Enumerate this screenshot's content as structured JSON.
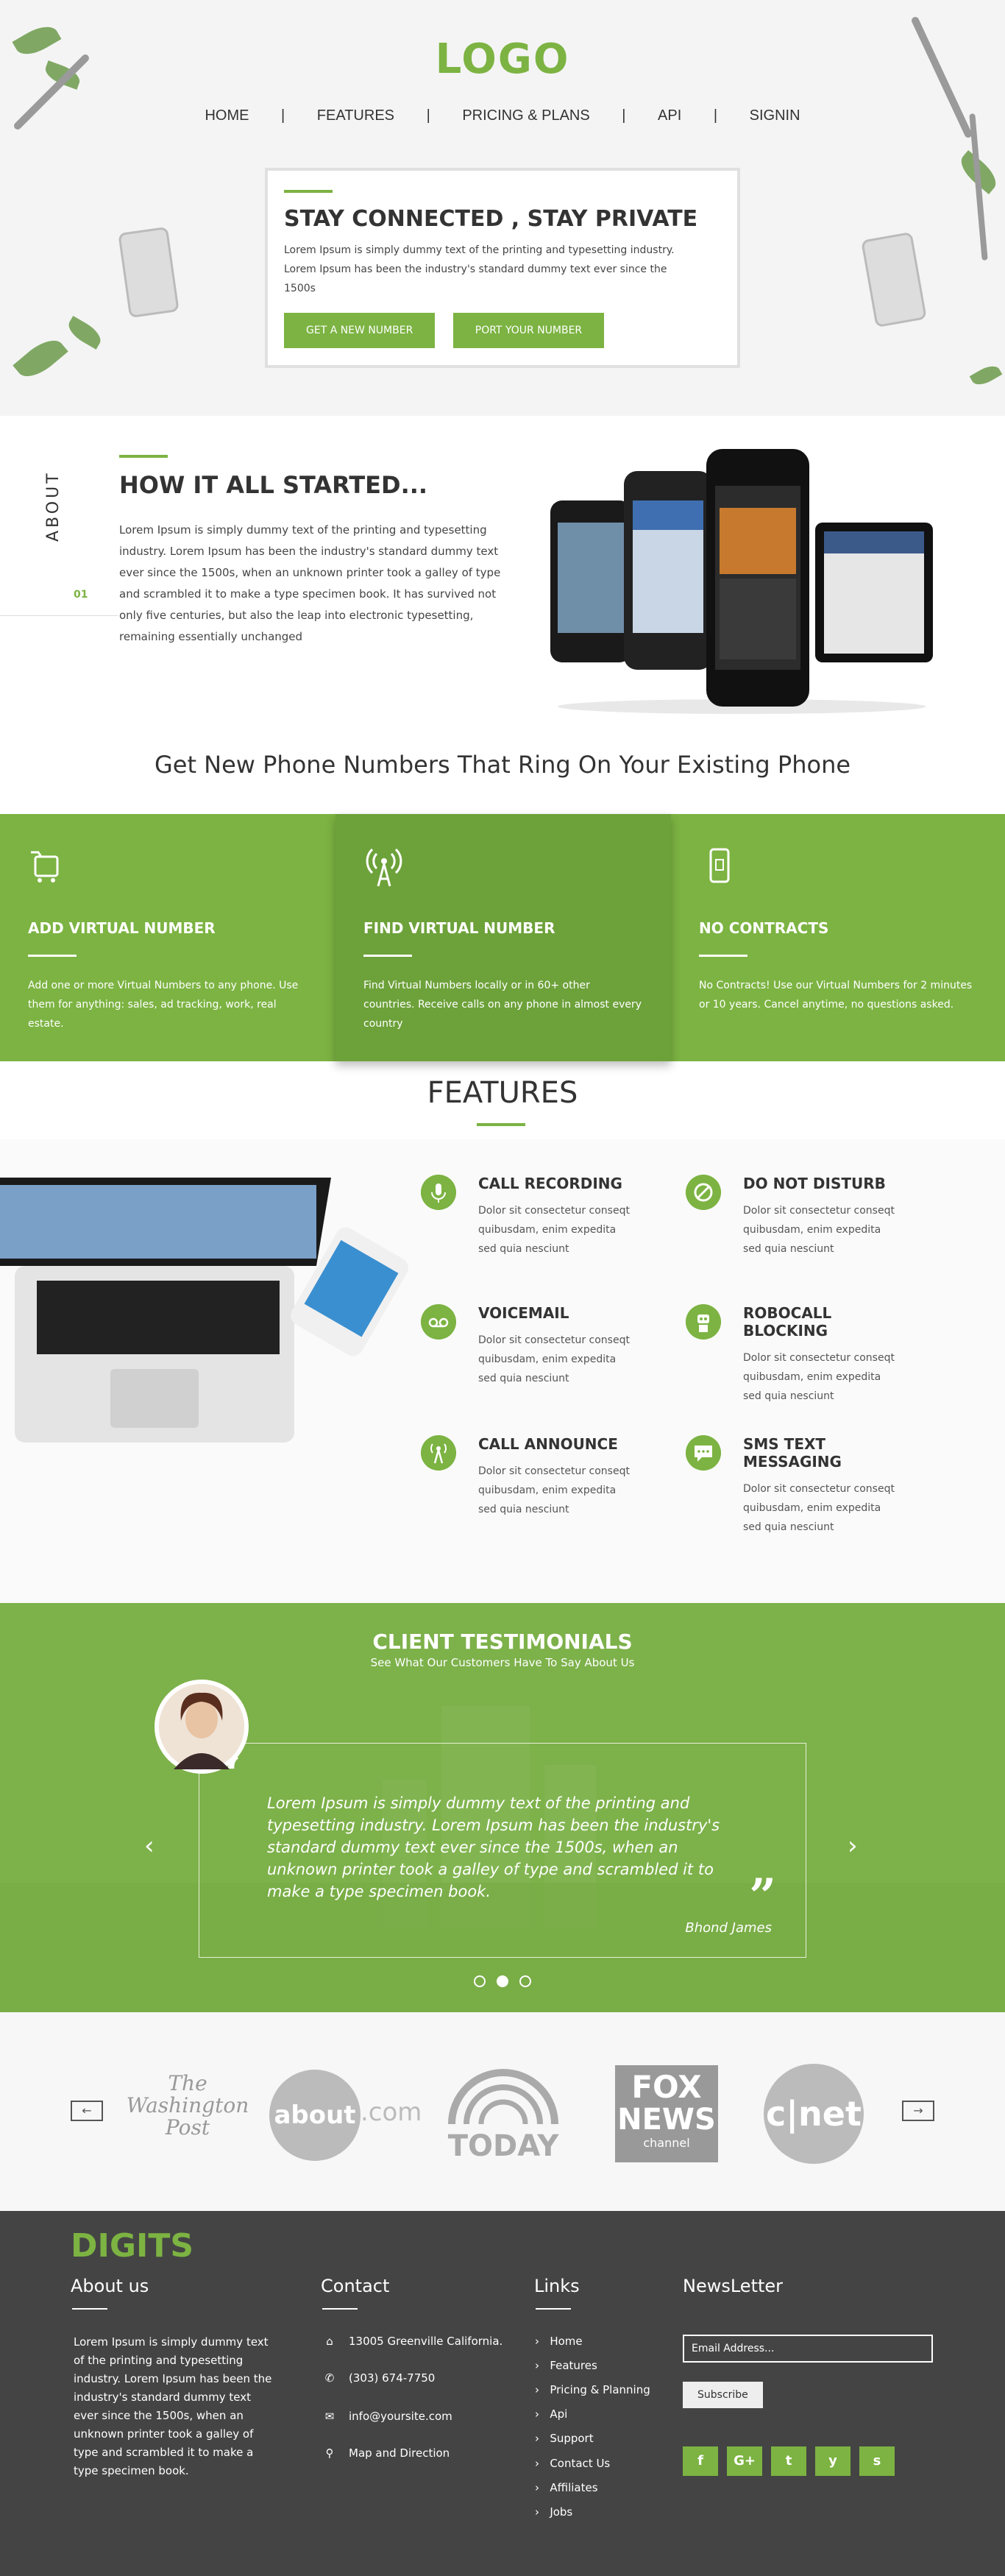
{
  "header": {
    "logo": "LOGO",
    "nav": [
      "HOME",
      "FEATURES",
      "PRICING & PLANS",
      "API",
      "SIGNIN"
    ],
    "hero_title": "STAY CONNECTED , STAY PRIVATE",
    "hero_text": "Lorem Ipsum is simply dummy text of the printing and typesetting industry. Lorem Ipsum has been the industry's standard dummy text ever since the 1500s",
    "btn_new": "GET A NEW NUMBER",
    "btn_port": "PORT YOUR NUMBER"
  },
  "about": {
    "label": "ABOUT",
    "number": "01",
    "title": "HOW IT ALL STARTED...",
    "text": "Lorem Ipsum is simply dummy text of the printing and typesetting industry. Lorem Ipsum has been the industry's standard dummy text ever since the 1500s, when an unknown printer took a galley of type and scrambled it to make a type specimen book. It has survived not only five centuries, but also the leap into electronic typesetting, remaining essentially unchanged"
  },
  "subheading": "Get New Phone Numbers That Ring On Your Existing Phone",
  "green_features": [
    {
      "title": "ADD VIRTUAL NUMBER",
      "text": "Add one or more Virtual Numbers to any phone. Use them for anything: sales, ad tracking, work, real estate."
    },
    {
      "title": "FIND VIRTUAL NUMBER",
      "text": "Find Virtual Numbers locally or in 60+ other countries. Receive calls on any phone in almost every country"
    },
    {
      "title": "NO CONTRACTS",
      "text": "No Contracts! Use our Virtual Numbers for 2 minutes or 10 years. Cancel anytime, no questions asked."
    }
  ],
  "features": {
    "title": "FEATURES",
    "items": [
      {
        "title": "CALL RECORDING",
        "text": "Dolor sit consectetur conseqt quibusdam, enim expedita sed quia nesciunt",
        "icon": "mic-icon"
      },
      {
        "title": "DO NOT DISTURB",
        "text": "Dolor sit consectetur conseqt quibusdam, enim expedita sed quia nesciunt",
        "icon": "block-icon"
      },
      {
        "title": "VOICEMAIL",
        "text": "Dolor sit consectetur conseqt quibusdam, enim expedita sed quia nesciunt",
        "icon": "voicemail-icon"
      },
      {
        "title": "ROBOCALL BLOCKING",
        "text": "Dolor sit consectetur conseqt quibusdam, enim expedita sed quia nesciunt",
        "icon": "robot-icon"
      },
      {
        "title": "CALL ANNOUNCE",
        "text": "Dolor sit consectetur conseqt quibusdam, enim expedita sed quia nesciunt",
        "icon": "antenna-icon"
      },
      {
        "title": "SMS TEXT MESSAGING",
        "text": "Dolor sit consectetur conseqt quibusdam, enim expedita sed quia nesciunt",
        "icon": "chat-icon"
      }
    ]
  },
  "testimonials": {
    "title": "CLIENT TESTIMONIALS",
    "subtitle": "See What Our Customers Have To Say About Us",
    "quote": "Lorem Ipsum is simply dummy text of the printing and typesetting industry. Lorem Ipsum has been the industry's standard dummy text ever since the 1500s, when an unknown printer took a galley of type and scrambled it to make a type specimen book.",
    "author": "Bhond James",
    "open_quote": "“",
    "close_quote": "”",
    "prev": "‹",
    "next": "›"
  },
  "press_logos": {
    "wp1": "The",
    "wp2": "Washington",
    "wp3": "Post",
    "about": "about",
    "about_com": ".com",
    "today": "TODAY",
    "fox1": "FOX",
    "fox2": "NEWS",
    "fox3": "channel",
    "cnet": "c|net"
  },
  "footer": {
    "brand": "DIGITS",
    "about_title": "About us",
    "about_text": "Lorem Ipsum is simply dummy text of the printing and typesetting industry. Lorem Ipsum has been the industry's standard dummy text ever since the 1500s, when an unknown printer took a galley of type and scrambled it to make a type specimen book.",
    "contact_title": "Contact",
    "contact": {
      "address": "13005 Greenville California.",
      "phone": "(303) 674-7750",
      "email": "info@yoursite.com",
      "map": "Map and Direction"
    },
    "links_title": "Links",
    "links": [
      "Home",
      "Features",
      "Pricing & Planning",
      "Api",
      "Support",
      "Contact Us",
      "Affiliates",
      "Jobs"
    ],
    "newsletter_title": "NewsLetter",
    "email_placeholder": "Email Address...",
    "subscribe": "Subscribe",
    "social": [
      "f",
      "G+",
      "t",
      "y",
      "s"
    ]
  },
  "colors": {
    "accent": "#7cb342",
    "footer_bg": "#444444"
  }
}
